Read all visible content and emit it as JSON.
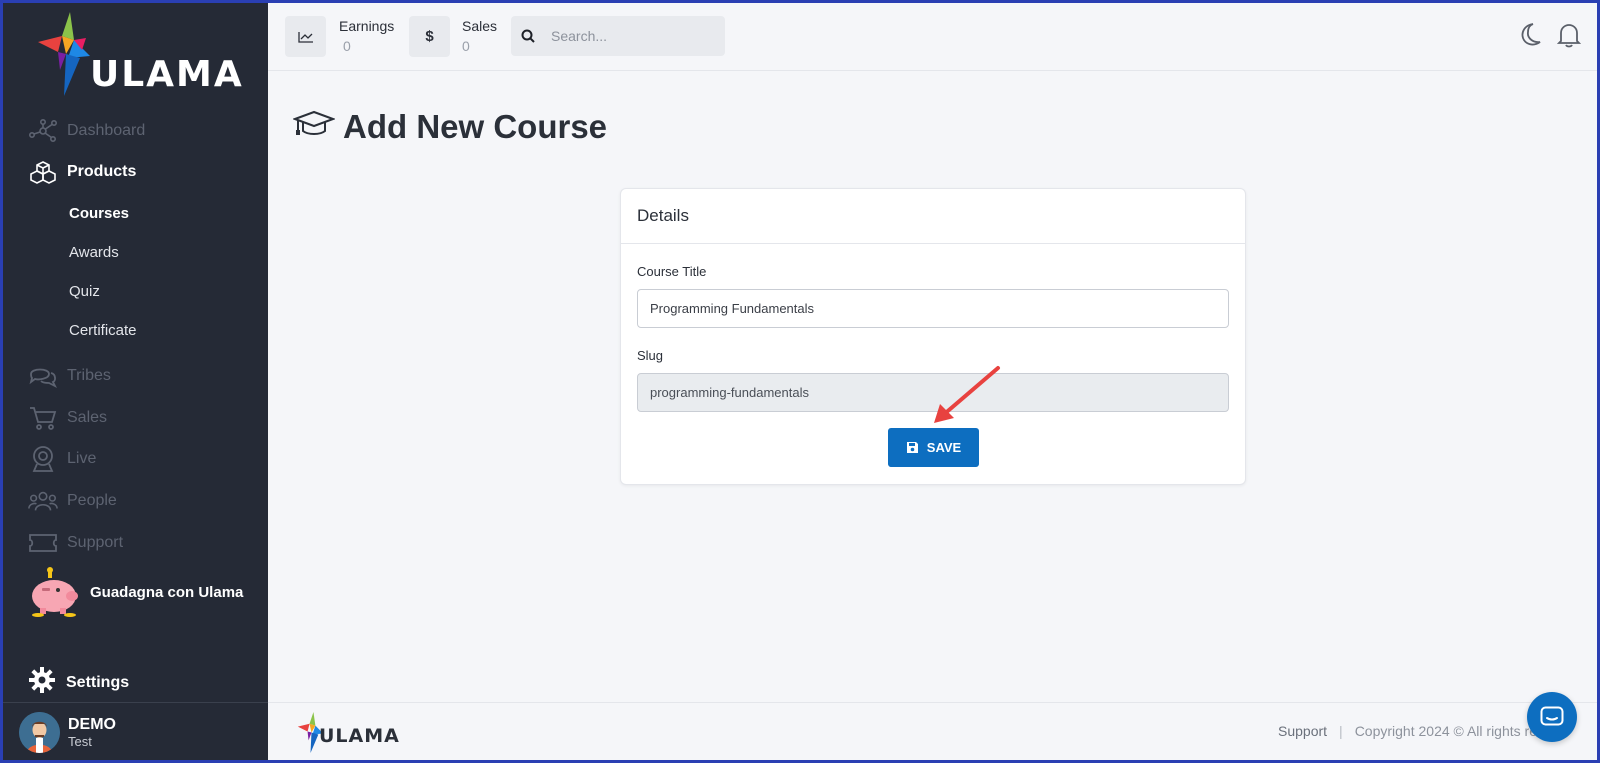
{
  "sidebar": {
    "logo_text": "ULAMA",
    "items": [
      {
        "label": "Dashboard",
        "icon": "network-icon"
      },
      {
        "label": "Products",
        "icon": "cubes-icon"
      },
      {
        "label": "Tribes",
        "icon": "chat-bubbles-icon"
      },
      {
        "label": "Sales",
        "icon": "cart-icon"
      },
      {
        "label": "Live",
        "icon": "webcam-icon"
      },
      {
        "label": "People",
        "icon": "people-icon"
      },
      {
        "label": "Support",
        "icon": "ticket-icon"
      }
    ],
    "subitems": [
      "Courses",
      "Awards",
      "Quiz",
      "Certificate"
    ],
    "earn_label": "Guadagna con Ulama",
    "settings_label": "Settings",
    "user": {
      "name": "DEMO",
      "role": "Test"
    }
  },
  "topbar": {
    "earnings_label": "Earnings",
    "earnings_value": "0",
    "sales_label": "Sales",
    "sales_value": "0",
    "search_placeholder": "Search..."
  },
  "main": {
    "title": "Add New Course",
    "card_title": "Details",
    "course_title_label": "Course Title",
    "course_title_value": "Programming Fundamentals",
    "slug_label": "Slug",
    "slug_value": "programming-fundamentals",
    "save_label": "SAVE"
  },
  "footer": {
    "logo_text": "ULAMA",
    "support": "Support",
    "copyright": "Copyright 2024 © All rights res"
  },
  "colors": {
    "sidebar_bg": "#252a36",
    "accent": "#0d6ec0",
    "arrow": "#e8423f"
  }
}
